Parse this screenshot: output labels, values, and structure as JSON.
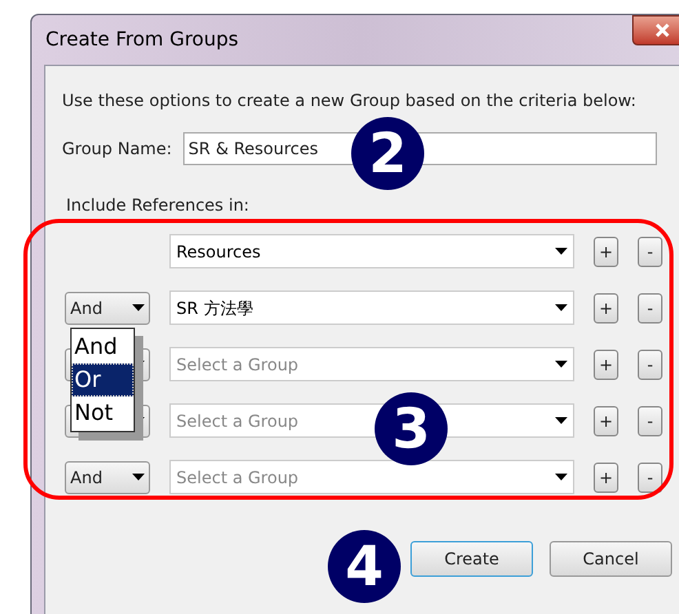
{
  "window": {
    "title": "Create From Groups"
  },
  "instruction": "Use these options to create a new Group based on the criteria below:",
  "group_name": {
    "label": "Group Name:",
    "value": "SR & Resources"
  },
  "include_label": "Include References in:",
  "rows": [
    {
      "operator": null,
      "value": "Resources",
      "placeholder": null,
      "add": "+",
      "remove": "-"
    },
    {
      "operator": "And",
      "value": "SR 方法學",
      "placeholder": null,
      "add": "+",
      "remove": "-"
    },
    {
      "operator": "",
      "value": null,
      "placeholder": "Select a Group",
      "add": "+",
      "remove": "-"
    },
    {
      "operator": "",
      "value": null,
      "placeholder": "Select a Group",
      "add": "+",
      "remove": "-"
    },
    {
      "operator": "And",
      "value": null,
      "placeholder": "Select a Group",
      "add": "+",
      "remove": "-"
    }
  ],
  "operator_menu": [
    {
      "label": "And",
      "selected": false
    },
    {
      "label": "Or",
      "selected": true
    },
    {
      "label": "Not",
      "selected": false
    }
  ],
  "callouts": [
    "2",
    "3",
    "4"
  ],
  "buttons": [
    {
      "label": "Create",
      "default": true
    },
    {
      "label": "Cancel",
      "default": false
    }
  ]
}
